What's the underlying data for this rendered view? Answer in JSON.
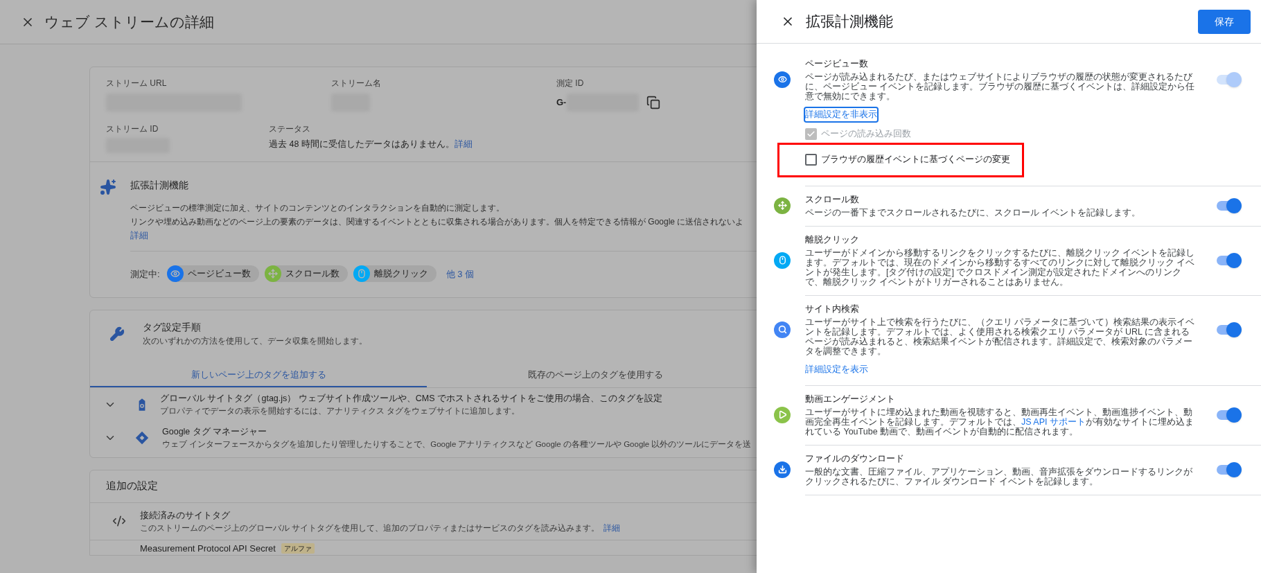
{
  "page": {
    "title": "ウェブ ストリームの詳細"
  },
  "stream": {
    "fields": [
      {
        "label": "ストリーム URL"
      },
      {
        "label": "ストリーム名"
      },
      {
        "label": "測定 ID",
        "prefix": "G-"
      }
    ],
    "stream_id": {
      "label": "ストリーム ID"
    },
    "status": {
      "label": "ステータス",
      "value": "過去 48 時間に受信したデータはありません。",
      "link": "詳細"
    }
  },
  "enhanced_measurement": {
    "title": "拡張計測機能",
    "description": [
      "ページビューの標準測定に加え、サイトのコンテンツとのインタラクションを自動的に測定します。",
      "リンクや埋め込み動画などのページ上の要素のデータは、関連するイベントとともに収集される場合があります。個人を特定できる情報が Google に送信されないよ"
    ],
    "link": "詳細",
    "measuring_label": "測定中:",
    "chips": [
      {
        "kind": "eye",
        "color": "#1a73e8",
        "label": "ページビュー数"
      },
      {
        "kind": "scroll",
        "color": "#7cb342",
        "label": "スクロール数"
      },
      {
        "kind": "mouse",
        "color": "#03a9f4",
        "label": "離脱クリック"
      }
    ],
    "more": "他 3 個"
  },
  "tag_setup": {
    "title": "タグ設定手順",
    "subtitle": "次のいずれかの方法を使用して、データ収集を開始します。",
    "tabs": [
      {
        "label": "新しいページ上のタグを追加する",
        "selected": true
      },
      {
        "label": "既存のページ上のタグを使用する",
        "selected": false
      }
    ],
    "options": [
      {
        "kind": "gtag",
        "expanded": false,
        "title": "グローバル サイトタグ（gtag.js） ウェブサイト作成ツールや、CMS でホストされるサイトをご使用の場合、このタグを設定",
        "subtitle": "プロパティでデータの表示を開始するには、アナリティクス タグをウェブサイトに追加します。"
      },
      {
        "kind": "gtm",
        "expanded": false,
        "title": "Google タグ マネージャー",
        "subtitle": "ウェブ インターフェースからタグを追加したり管理したりすることで、Google アナリティクスなど Google の各種ツールや Google 以外のツールにデータを送"
      }
    ]
  },
  "additional_settings": {
    "title": "追加の設定",
    "items": [
      {
        "kind": "code",
        "title": "接続済みのサイトタグ",
        "description": "このストリームのページ上のグローバル サイトタグを使用して、追加のプロパティまたはサービスのタグを読み込みます。",
        "link": "詳細"
      },
      {
        "kind": "none",
        "title": "Measurement Protocol API Secret",
        "badge": "アルファ"
      }
    ]
  },
  "panel": {
    "title": "拡張計測機能",
    "save": "保存",
    "items": [
      {
        "kind": "eye",
        "color": "#1a73e8",
        "title": "ページビュー数",
        "description": "ページが読み込まれるたび、またはウェブサイトによりブラウザの履歴の状態が変更されるたびに、ページビュー イベントを記録します。ブラウザの履歴に基づくイベントは、詳細設定から任意で無効にできます。",
        "link": "詳細設定を非表示",
        "link_focused": true,
        "on": true,
        "disabled": true,
        "options": [
          {
            "label": "ページの読み込み回数",
            "checked": true,
            "disabled": true,
            "highlighted": false
          },
          {
            "label": "ブラウザの履歴イベントに基づくページの変更",
            "checked": false,
            "disabled": false,
            "highlighted": true
          }
        ]
      },
      {
        "kind": "scroll",
        "color": "#7cb342",
        "title": "スクロール数",
        "description": "ページの一番下までスクロールされるたびに、スクロール イベントを記録します。",
        "on": true,
        "disabled": false
      },
      {
        "kind": "mouse",
        "color": "#03a9f4",
        "title": "離脱クリック",
        "description": "ユーザーがドメインから移動するリンクをクリックするたびに、離脱クリック イベントを記録します。デフォルトでは、現在のドメインから移動するすべてのリンクに対して離脱クリック イベントが発生します。[タグ付けの設定] でクロスドメイン測定が設定されたドメインへのリンクで、離脱クリック イベントがトリガーされることはありません。",
        "on": true,
        "disabled": false
      },
      {
        "kind": "search",
        "color": "#4285f4",
        "title": "サイト内検索",
        "description": "ユーザーがサイト上で検索を行うたびに、（クエリ パラメータに基づいて）検索結果の表示イベントを記録します。デフォルトでは、よく使用される検索クエリ パラメータが URL に含まれるページが読み込まれると、検索結果イベントが配信されます。詳細設定で、検索対象のパラメータを調整できます。",
        "link": "詳細設定を表示",
        "link_focused": false,
        "on": true,
        "disabled": false
      },
      {
        "kind": "play",
        "color": "#8bc34a",
        "title": "動画エンゲージメント",
        "description": "ユーザーがサイトに埋め込まれた動画を視聴すると、動画再生イベント、動画進捗イベント、動画完全再生イベントを記録します。デフォルトでは、",
        "inline_link": "JS API サポート",
        "description_end": "が有効なサイトに埋め込まれている YouTube 動画で、動画イベントが自動的に配信されます。",
        "on": true,
        "disabled": false
      },
      {
        "kind": "download",
        "color": "#1a73e8",
        "title": "ファイルのダウンロード",
        "description": "一般的な文書、圧縮ファイル、アプリケーション、動画、音声拡張をダウンロードするリンクがクリックされるたびに、ファイル ダウンロード イベントを記録します。",
        "on": true,
        "disabled": false
      }
    ]
  }
}
